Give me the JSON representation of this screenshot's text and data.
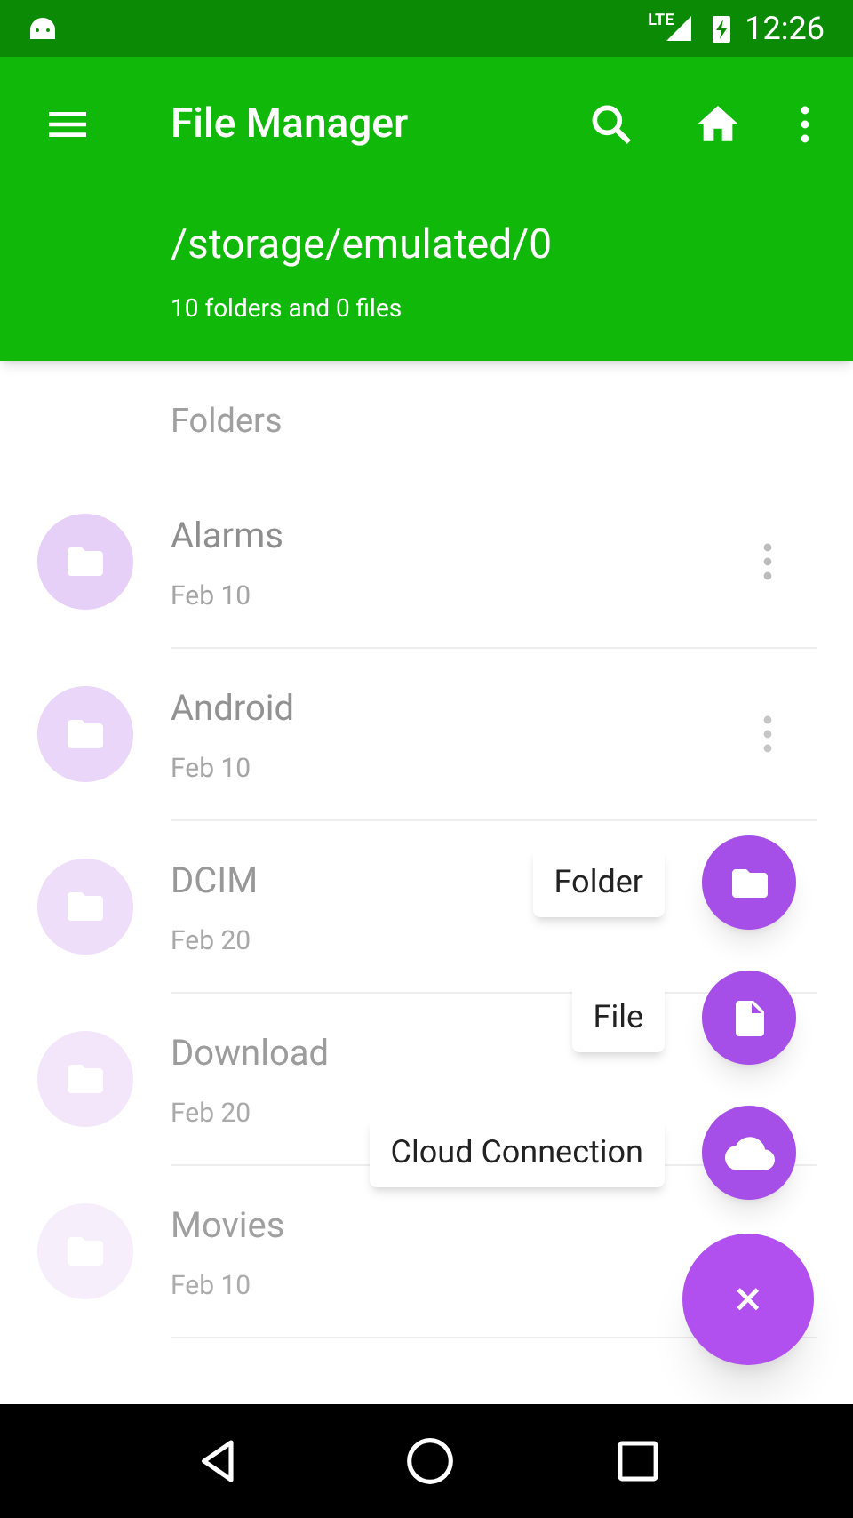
{
  "status_bar": {
    "time": "12:26",
    "network": "LTE"
  },
  "app_bar": {
    "title": "File Manager",
    "path": "/storage/emulated/0",
    "summary": "10 folders and 0 files"
  },
  "section_header": "Folders",
  "folders": [
    {
      "name": "Alarms",
      "date": "Feb 10"
    },
    {
      "name": "Android",
      "date": "Feb 10"
    },
    {
      "name": "DCIM",
      "date": "Feb 20"
    },
    {
      "name": "Download",
      "date": "Feb 20"
    },
    {
      "name": "Movies",
      "date": "Feb 10"
    }
  ],
  "fab_menu": {
    "expanded": true,
    "actions": [
      {
        "label": "Folder",
        "kind": "folder"
      },
      {
        "label": "File",
        "kind": "file"
      },
      {
        "label": "Cloud Connection",
        "kind": "cloud"
      }
    ],
    "close": "×"
  }
}
